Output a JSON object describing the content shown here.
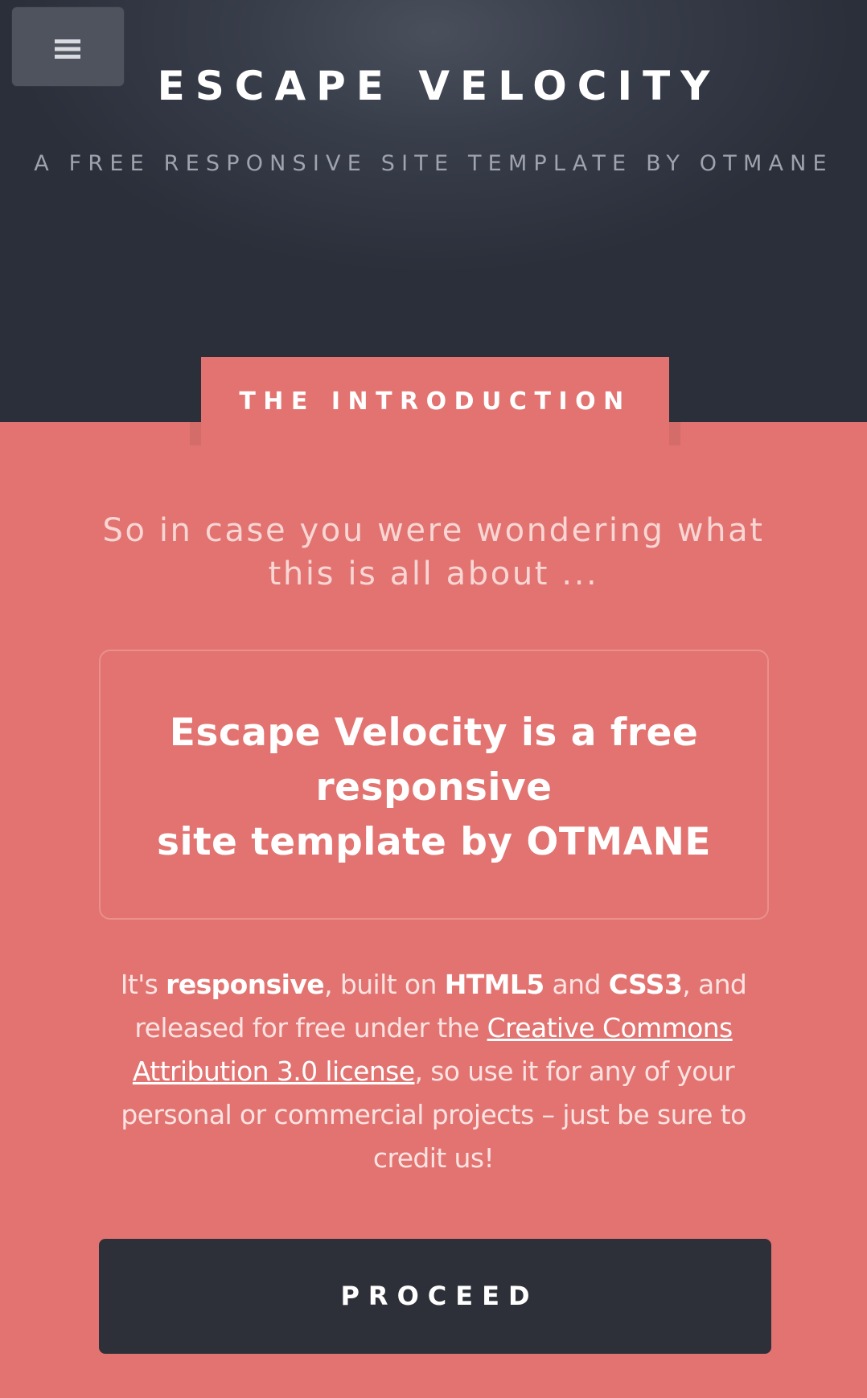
{
  "header": {
    "menu_icon": "hamburger-icon",
    "title": "ESCAPE VELOCITY",
    "subtitle": "A FREE RESPONSIVE SITE TEMPLATE BY OTMANE"
  },
  "intro": {
    "tab_label": "THE INTRODUCTION",
    "tagline": "So in case you were wondering what this is all about ...",
    "feature_lines": [
      "Escape Velocity is a free",
      "responsive",
      "site template by OTMANE"
    ],
    "body": {
      "t1": "It's ",
      "b1": "responsive",
      "t2": ", built on ",
      "b2": "HTML5",
      "t3": " and ",
      "b3": "CSS3",
      "t4": ", and released for free under the ",
      "link": "Creative Commons Attribution 3.0 license",
      "t5": ", so use it for any of your personal or commercial projects – just be sure to credit us!"
    },
    "button_label": "PROCEED"
  },
  "colors": {
    "header_bg": "#2b2f3a",
    "accent": "#e27370",
    "button_bg": "#2d3039"
  }
}
